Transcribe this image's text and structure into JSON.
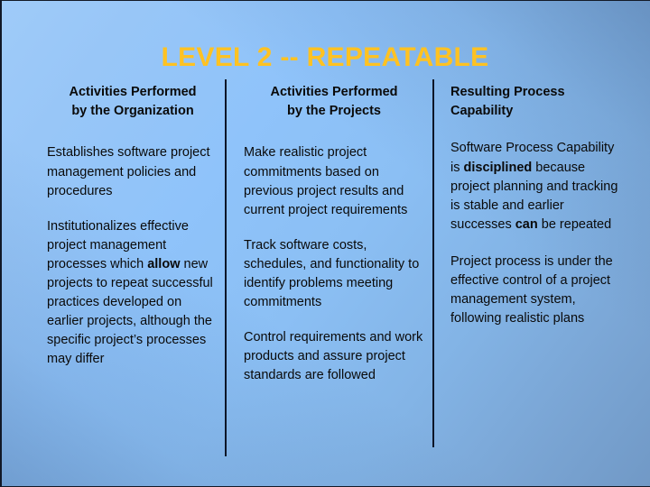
{
  "slide": {
    "title": "LEVEL 2 -- REPEATABLE",
    "title_color": "#FFC222",
    "text_color": "#0A0A0A",
    "divider_color": "#0D1628",
    "background_colors": [
      "#9FCBF9",
      "#8FC3FA",
      "#7199C6"
    ]
  },
  "columns": [
    {
      "header": "Activities Performed\nby the Organization",
      "paragraphs": [
        {
          "parts": [
            {
              "text": "Establishes software project management policies and procedures",
              "bold": false
            }
          ]
        },
        {
          "parts": [
            {
              "text": "Institutionalizes effective project management processes which ",
              "bold": false
            },
            {
              "text": "allow",
              "bold": true
            },
            {
              "text": " new projects to repeat successful practices developed on earlier projects, although the specific project’s processes may differ",
              "bold": false
            }
          ]
        }
      ]
    },
    {
      "header": "Activities Performed\nby the Projects",
      "paragraphs": [
        {
          "parts": [
            {
              "text": "Make realistic project commitments based on previous project results and current project requirements",
              "bold": false
            }
          ]
        },
        {
          "parts": [
            {
              "text": "Track software costs, schedules, and functionality to identify problems meeting commitments",
              "bold": false
            }
          ]
        },
        {
          "parts": [
            {
              "text": "Control requirements and work products and assure project standards are followed",
              "bold": false
            }
          ]
        }
      ]
    },
    {
      "header": "Resulting Process\nCapability",
      "paragraphs": [
        {
          "parts": [
            {
              "text": "Software Process Capability is ",
              "bold": false
            },
            {
              "text": "disciplined",
              "bold": true
            },
            {
              "text": " because project planning and tracking is stable and earlier successes ",
              "bold": false
            },
            {
              "text": "can",
              "bold": true
            },
            {
              "text": " be repeated",
              "bold": false
            }
          ]
        },
        {
          "parts": [
            {
              "text": "Project process is under the effective control of a project management system, following realistic plans",
              "bold": false
            }
          ]
        }
      ]
    }
  ]
}
